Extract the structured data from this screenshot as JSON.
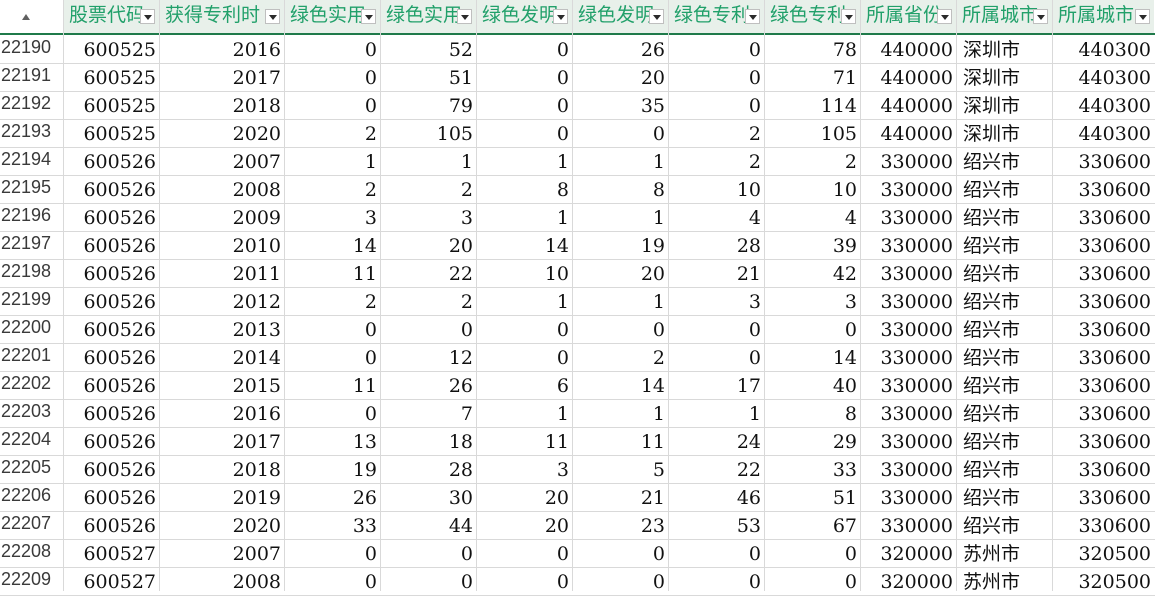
{
  "headers": [
    "股票代码",
    "获得专利时",
    "绿色实用",
    "绿色实用",
    "绿色发明",
    "绿色发明",
    "绿色专利",
    "绿色专利",
    "所属省份",
    "所属城市",
    "所属城市"
  ],
  "rows": [
    {
      "n": "22190",
      "v": [
        "600525",
        "2016",
        "0",
        "52",
        "0",
        "26",
        "0",
        "78",
        "440000",
        "深圳市",
        "440300"
      ]
    },
    {
      "n": "22191",
      "v": [
        "600525",
        "2017",
        "0",
        "51",
        "0",
        "20",
        "0",
        "71",
        "440000",
        "深圳市",
        "440300"
      ]
    },
    {
      "n": "22192",
      "v": [
        "600525",
        "2018",
        "0",
        "79",
        "0",
        "35",
        "0",
        "114",
        "440000",
        "深圳市",
        "440300"
      ]
    },
    {
      "n": "22193",
      "v": [
        "600525",
        "2020",
        "2",
        "105",
        "0",
        "0",
        "2",
        "105",
        "440000",
        "深圳市",
        "440300"
      ]
    },
    {
      "n": "22194",
      "v": [
        "600526",
        "2007",
        "1",
        "1",
        "1",
        "1",
        "2",
        "2",
        "330000",
        "绍兴市",
        "330600"
      ]
    },
    {
      "n": "22195",
      "v": [
        "600526",
        "2008",
        "2",
        "2",
        "8",
        "8",
        "10",
        "10",
        "330000",
        "绍兴市",
        "330600"
      ]
    },
    {
      "n": "22196",
      "v": [
        "600526",
        "2009",
        "3",
        "3",
        "1",
        "1",
        "4",
        "4",
        "330000",
        "绍兴市",
        "330600"
      ]
    },
    {
      "n": "22197",
      "v": [
        "600526",
        "2010",
        "14",
        "20",
        "14",
        "19",
        "28",
        "39",
        "330000",
        "绍兴市",
        "330600"
      ]
    },
    {
      "n": "22198",
      "v": [
        "600526",
        "2011",
        "11",
        "22",
        "10",
        "20",
        "21",
        "42",
        "330000",
        "绍兴市",
        "330600"
      ]
    },
    {
      "n": "22199",
      "v": [
        "600526",
        "2012",
        "2",
        "2",
        "1",
        "1",
        "3",
        "3",
        "330000",
        "绍兴市",
        "330600"
      ]
    },
    {
      "n": "22200",
      "v": [
        "600526",
        "2013",
        "0",
        "0",
        "0",
        "0",
        "0",
        "0",
        "330000",
        "绍兴市",
        "330600"
      ]
    },
    {
      "n": "22201",
      "v": [
        "600526",
        "2014",
        "0",
        "12",
        "0",
        "2",
        "0",
        "14",
        "330000",
        "绍兴市",
        "330600"
      ]
    },
    {
      "n": "22202",
      "v": [
        "600526",
        "2015",
        "11",
        "26",
        "6",
        "14",
        "17",
        "40",
        "330000",
        "绍兴市",
        "330600"
      ]
    },
    {
      "n": "22203",
      "v": [
        "600526",
        "2016",
        "0",
        "7",
        "1",
        "1",
        "1",
        "8",
        "330000",
        "绍兴市",
        "330600"
      ]
    },
    {
      "n": "22204",
      "v": [
        "600526",
        "2017",
        "13",
        "18",
        "11",
        "11",
        "24",
        "29",
        "330000",
        "绍兴市",
        "330600"
      ]
    },
    {
      "n": "22205",
      "v": [
        "600526",
        "2018",
        "19",
        "28",
        "3",
        "5",
        "22",
        "33",
        "330000",
        "绍兴市",
        "330600"
      ]
    },
    {
      "n": "22206",
      "v": [
        "600526",
        "2019",
        "26",
        "30",
        "20",
        "21",
        "46",
        "51",
        "330000",
        "绍兴市",
        "330600"
      ]
    },
    {
      "n": "22207",
      "v": [
        "600526",
        "2020",
        "33",
        "44",
        "20",
        "23",
        "53",
        "67",
        "330000",
        "绍兴市",
        "330600"
      ]
    },
    {
      "n": "22208",
      "v": [
        "600527",
        "2007",
        "0",
        "0",
        "0",
        "0",
        "0",
        "0",
        "320000",
        "苏州市",
        "320500"
      ]
    },
    {
      "n": "22209",
      "v": [
        "600527",
        "2008",
        "0",
        "0",
        "0",
        "0",
        "0",
        "0",
        "320000",
        "苏州市",
        "320500"
      ]
    }
  ]
}
